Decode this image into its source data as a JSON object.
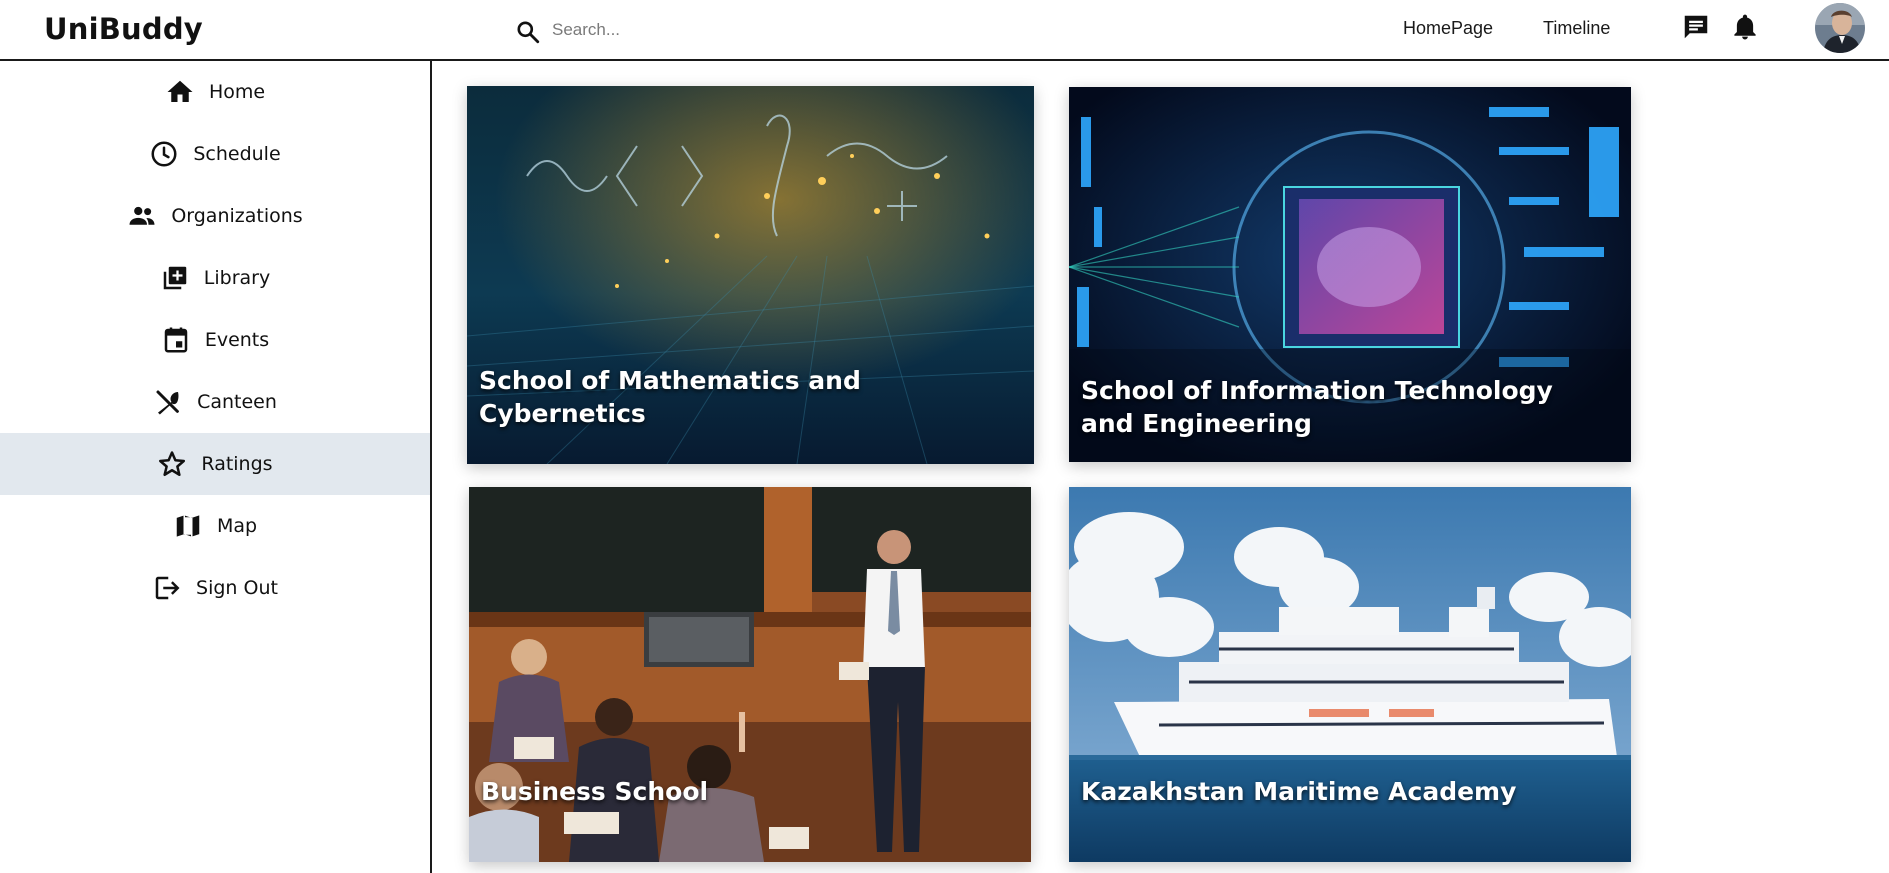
{
  "app": {
    "brand": "UniBuddy"
  },
  "search": {
    "placeholder": "Search..."
  },
  "header": {
    "nav": [
      {
        "label": "HomePage"
      },
      {
        "label": "Timeline"
      }
    ],
    "icons": [
      "message-icon",
      "bell-icon"
    ],
    "avatar": "user-avatar"
  },
  "sidebar": {
    "items": [
      {
        "label": "Home",
        "icon": "home-icon"
      },
      {
        "label": "Schedule",
        "icon": "clock-icon"
      },
      {
        "label": "Organizations",
        "icon": "people-icon"
      },
      {
        "label": "Library",
        "icon": "library-add-icon"
      },
      {
        "label": "Events",
        "icon": "calendar-icon"
      },
      {
        "label": "Canteen",
        "icon": "cutlery-icon"
      },
      {
        "label": "Ratings",
        "icon": "star-icon",
        "active": true
      },
      {
        "label": "Map",
        "icon": "map-icon"
      },
      {
        "label": "Sign Out",
        "icon": "sign-out-icon"
      }
    ]
  },
  "schools": [
    {
      "title": "School of Mathematics and Cybernetics"
    },
    {
      "title": "School of Information Technology and Engineering"
    },
    {
      "title": "Business School"
    },
    {
      "title": "Kazakhstan Maritime Academy"
    }
  ],
  "colors": {
    "active_bg": "#e2e8ee",
    "border": "#1a1a1a",
    "sea": "#1f5f8f",
    "sky": "#5a8fc0"
  }
}
